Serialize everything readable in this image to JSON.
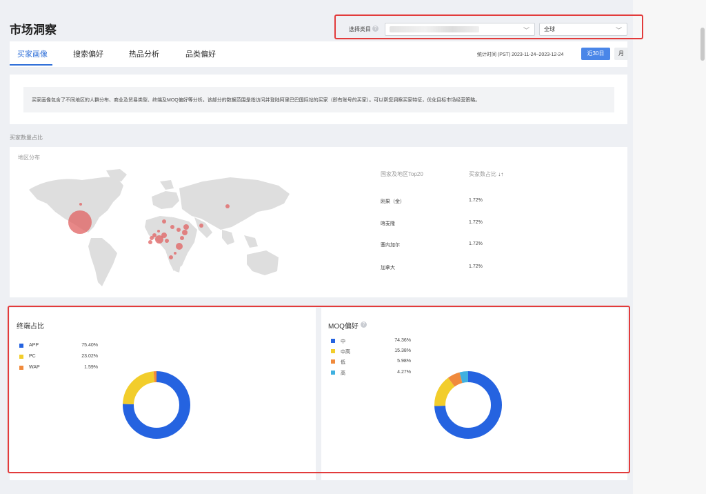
{
  "page": {
    "title": "市场洞察"
  },
  "selector": {
    "label": "选择类目",
    "help_icon": "question-circle-icon",
    "category_value": "",
    "region_value": "全球"
  },
  "tabs": [
    {
      "label": "买家画像",
      "active": true
    },
    {
      "label": "搜索偏好",
      "active": false
    },
    {
      "label": "热品分析",
      "active": false
    },
    {
      "label": "品类偏好",
      "active": false
    }
  ],
  "time": {
    "label": "统计时间 (PST) 2023-11-24~2023-12-24",
    "btn_30": "近30日",
    "btn_month": "月"
  },
  "description": "买家画像包含了不同地区的人群分布、商业及贸易类型、终端及MOQ偏好等分析。该部分的数据范围是指访问并登陆阿里巴巴国际站的买家（即有账号的买家）。可以帮您洞察买家特征，优化目标市场经营策略。",
  "buyer_section": {
    "label": "买家数量占比",
    "map_title": "地区分布",
    "table_headers": [
      "国家及地区Top20",
      "买家数占比"
    ],
    "sort_icon": "sort-arrows-icon",
    "rows": [
      {
        "country": "刚果（金）",
        "share": "1.72%"
      },
      {
        "country": "喀麦隆",
        "share": "1.72%"
      },
      {
        "country": "塞内加尔",
        "share": "1.72%"
      },
      {
        "country": "加拿大",
        "share": "1.72%"
      }
    ]
  },
  "terminal": {
    "title": "终端占比",
    "legend": [
      {
        "name": "APP",
        "value": "75.40%",
        "color": "#2563e0"
      },
      {
        "name": "PC",
        "value": "23.02%",
        "color": "#f2cd2b"
      },
      {
        "name": "WAP",
        "value": "1.59%",
        "color": "#f08a3c"
      }
    ]
  },
  "moq": {
    "title": "MOQ偏好",
    "help_icon": "question-circle-icon",
    "legend": [
      {
        "name": "中",
        "value": "74.36%",
        "color": "#2563e0"
      },
      {
        "name": "中高",
        "value": "15.38%",
        "color": "#f2cd2b"
      },
      {
        "name": "低",
        "value": "5.98%",
        "color": "#f08a3c"
      },
      {
        "name": "高",
        "value": "4.27%",
        "color": "#3fb0e0"
      }
    ]
  },
  "chart_data": [
    {
      "type": "pie",
      "title": "终端占比",
      "categories": [
        "APP",
        "PC",
        "WAP"
      ],
      "values": [
        75.4,
        23.02,
        1.59
      ]
    },
    {
      "type": "pie",
      "title": "MOQ偏好",
      "categories": [
        "中",
        "中高",
        "低",
        "高"
      ],
      "values": [
        74.36,
        15.38,
        5.98,
        4.27
      ]
    }
  ]
}
